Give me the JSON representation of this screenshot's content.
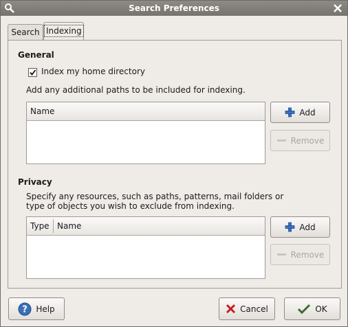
{
  "window": {
    "title": "Search Preferences"
  },
  "tabs": [
    {
      "label": "Search",
      "active": false
    },
    {
      "label": "Indexing",
      "active": true
    }
  ],
  "general": {
    "heading": "General",
    "index_home_label": "Index my home directory",
    "index_home_checked": true,
    "paths_hint": "Add any additional paths to be included for indexing.",
    "paths_columns": [
      "Name"
    ],
    "paths_rows": [],
    "add_label": "Add",
    "remove_label": "Remove"
  },
  "privacy": {
    "heading": "Privacy",
    "hint_line1": "Specify any resources, such as paths, patterns, mail folders or",
    "hint_line2": "type of objects you wish to exclude from indexing.",
    "columns": [
      "Type",
      "Name"
    ],
    "rows": [],
    "add_label": "Add",
    "remove_label": "Remove"
  },
  "footer": {
    "help_label": "Help",
    "cancel_label": "Cancel",
    "ok_label": "OK"
  }
}
